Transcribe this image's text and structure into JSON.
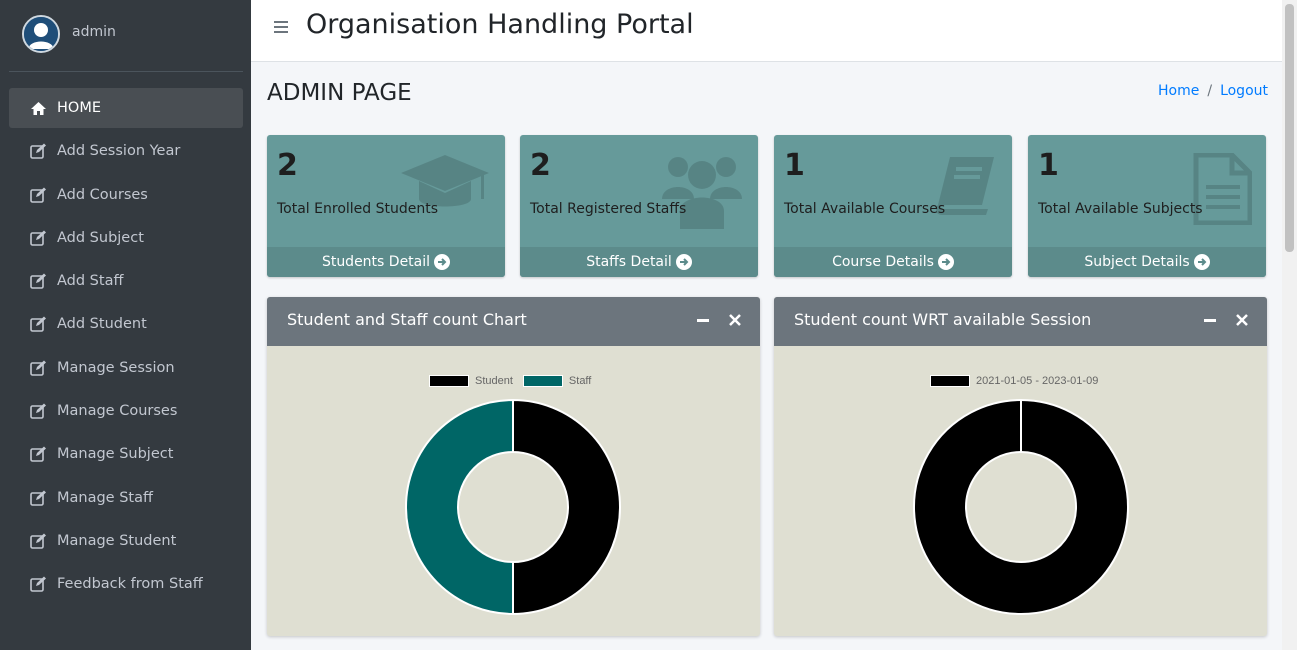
{
  "sidebar": {
    "user": "admin",
    "items": [
      {
        "label": "HOME",
        "icon": "home-icon"
      },
      {
        "label": "Add Session Year",
        "icon": "edit-icon"
      },
      {
        "label": "Add Courses",
        "icon": "edit-icon"
      },
      {
        "label": "Add Subject",
        "icon": "edit-icon"
      },
      {
        "label": "Add Staff",
        "icon": "edit-icon"
      },
      {
        "label": "Add Student",
        "icon": "edit-icon"
      },
      {
        "label": "Manage Session",
        "icon": "edit-icon"
      },
      {
        "label": "Manage Courses",
        "icon": "edit-icon"
      },
      {
        "label": "Manage Subject",
        "icon": "edit-icon"
      },
      {
        "label": "Manage Staff",
        "icon": "edit-icon"
      },
      {
        "label": "Manage Student",
        "icon": "edit-icon"
      },
      {
        "label": "Feedback from Staff",
        "icon": "edit-icon"
      }
    ]
  },
  "header": {
    "title": "Organisation Handling Portal"
  },
  "page": {
    "title": "ADMIN PAGE"
  },
  "breadcrumb": {
    "home": "Home",
    "separator": "/",
    "logout": "Logout"
  },
  "stats": [
    {
      "value": "2",
      "label": "Total Enrolled Students",
      "link": "Students Detail",
      "icon": "graduation-cap-icon"
    },
    {
      "value": "2",
      "label": "Total Registered Staffs",
      "link": "Staffs Detail",
      "icon": "users-icon"
    },
    {
      "value": "1",
      "label": "Total Available Courses",
      "link": "Course Details",
      "icon": "book-icon"
    },
    {
      "value": "1",
      "label": "Total Available Subjects",
      "link": "Subject Details",
      "icon": "document-icon"
    }
  ],
  "colors": {
    "series_black": "#000000",
    "series_teal": "#006666",
    "box_bg": "#669a9a",
    "chart_bg": "#dfdfd2"
  },
  "chart_data": [
    {
      "type": "pie",
      "title": "Student and Staff count Chart",
      "legend": [
        "Student",
        "Staff"
      ],
      "values": [
        2,
        2
      ],
      "colors": [
        "#000000",
        "#006666"
      ],
      "legend_position": "top"
    },
    {
      "type": "pie",
      "title": "Student count WRT available Session",
      "legend": [
        "2021-01-05 - 2023-01-09"
      ],
      "values": [
        2
      ],
      "colors": [
        "#000000"
      ],
      "legend_position": "top"
    }
  ]
}
